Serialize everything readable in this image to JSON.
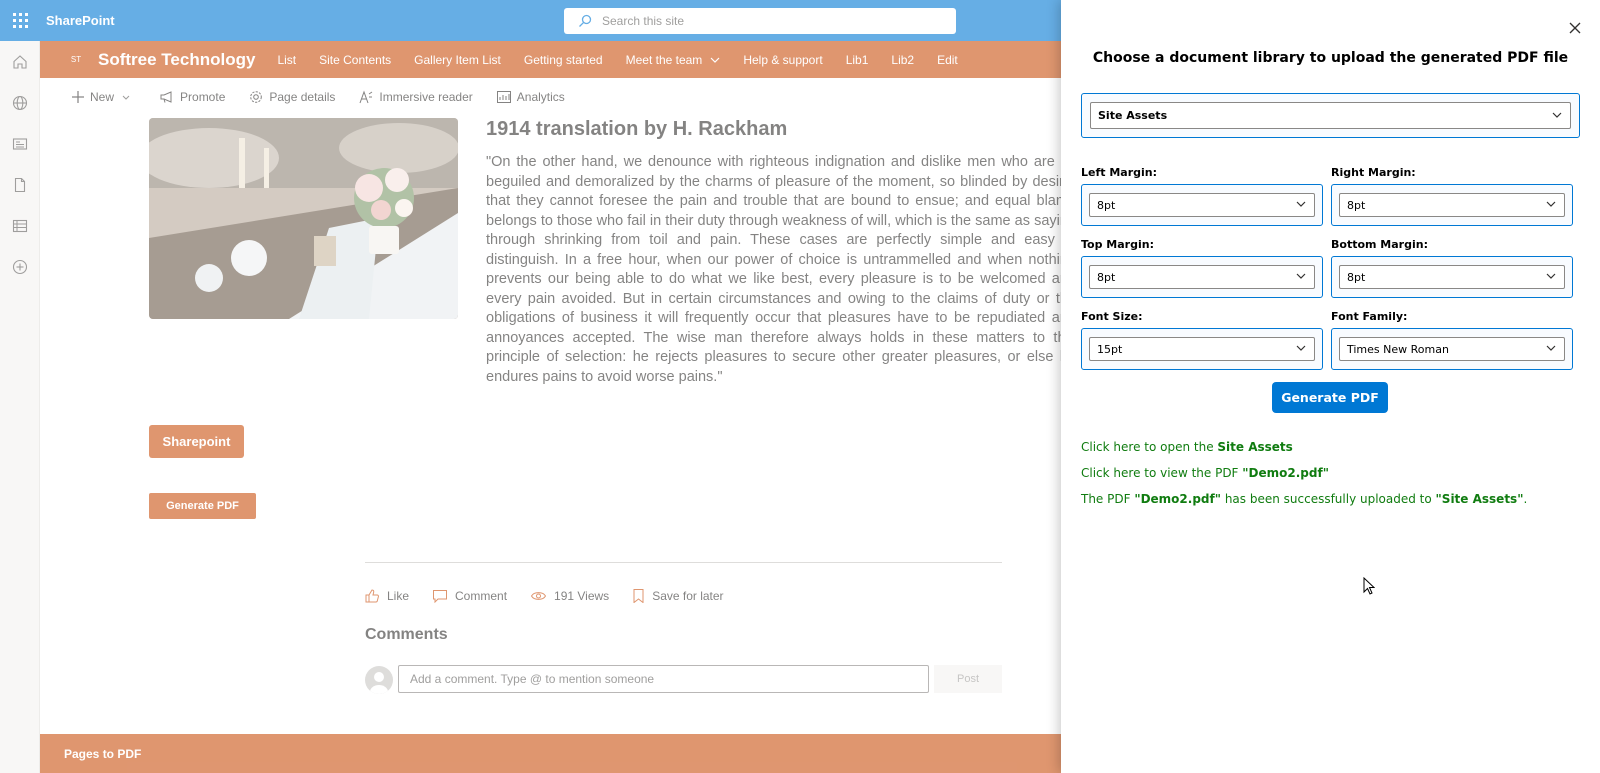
{
  "suitebar": {
    "brand": "SharePoint",
    "search_placeholder": "Search this site"
  },
  "leftrail": {
    "icons": [
      "home-icon",
      "globe-icon",
      "news-icon",
      "document-icon",
      "list-icon",
      "add-circle-icon"
    ]
  },
  "siteheader": {
    "logo_text": "ST",
    "site_name": "Softree Technology",
    "nav": [
      "List",
      "Site Contents",
      "Gallery Item List",
      "Getting started",
      "Meet the team",
      "Help & support",
      "Lib1",
      "Lib2",
      "Edit"
    ]
  },
  "cmdbar": {
    "new": "New",
    "promote": "Promote",
    "page_details": "Page details",
    "immersive_reader": "Immersive reader",
    "analytics": "Analytics"
  },
  "article": {
    "title": "1914 translation by H. Rackham",
    "body": "\"On the other hand, we denounce with righteous indignation and dislike men who are so beguiled and demoralized by the charms of pleasure of the moment, so blinded by desire, that they cannot foresee the pain and trouble that are bound to ensue; and equal blame belongs to those who fail in their duty through weakness of will, which is the same as saying through shrinking from toil and pain. These cases are perfectly simple and easy to distinguish. In a free hour, when our power of choice is untrammelled and when nothing prevents our being able to do what we like best, every pleasure is to be welcomed and every pain avoided. But in certain circumstances and owing to the claims of duty or the obligations of business it will frequently occur that pleasures have to be repudiated and annoyances accepted. The wise man therefore always holds in these matters to this principle of selection: he rejects pleasures to secure other greater pleasures, or else he endures pains to avoid worse pains.\""
  },
  "buttons": {
    "sharepoint": "Sharepoint",
    "generate_pdf_page": "Generate PDF"
  },
  "social": {
    "like": "Like",
    "comment": "Comment",
    "views": "191 Views",
    "save": "Save for later"
  },
  "comments": {
    "heading": "Comments",
    "placeholder": "Add a comment. Type @ to mention someone",
    "post": "Post"
  },
  "footer": {
    "text": "Pages to PDF"
  },
  "panel": {
    "title": "Choose a document library to upload the generated PDF file",
    "library": "Site Assets",
    "left_margin_label": "Left Margin:",
    "left_margin": "8pt",
    "right_margin_label": "Right Margin:",
    "right_margin": "8pt",
    "top_margin_label": "Top Margin:",
    "top_margin": "8pt",
    "bottom_margin_label": "Bottom Margin:",
    "bottom_margin": "8pt",
    "font_size_label": "Font Size:",
    "font_size": "15pt",
    "font_family_label": "Font Family:",
    "font_family": "Times New Roman",
    "generate_label": "Generate PDF",
    "msg_open_prefix": "Click here to open the ",
    "msg_open_target": "Site Assets",
    "msg_view_prefix": "Click here to view the PDF ",
    "msg_view_file": "\"Demo2.pdf\"",
    "msg_success_1": "The PDF ",
    "msg_success_file": "\"Demo2.pdf\"",
    "msg_success_2": " has been successfully uploaded to ",
    "msg_success_lib": "\"Site Assets\"",
    "msg_success_end": "."
  },
  "colors": {
    "suite_blue": "#0078d4",
    "brand_orange": "#ca5010",
    "success_green": "#107c10"
  }
}
